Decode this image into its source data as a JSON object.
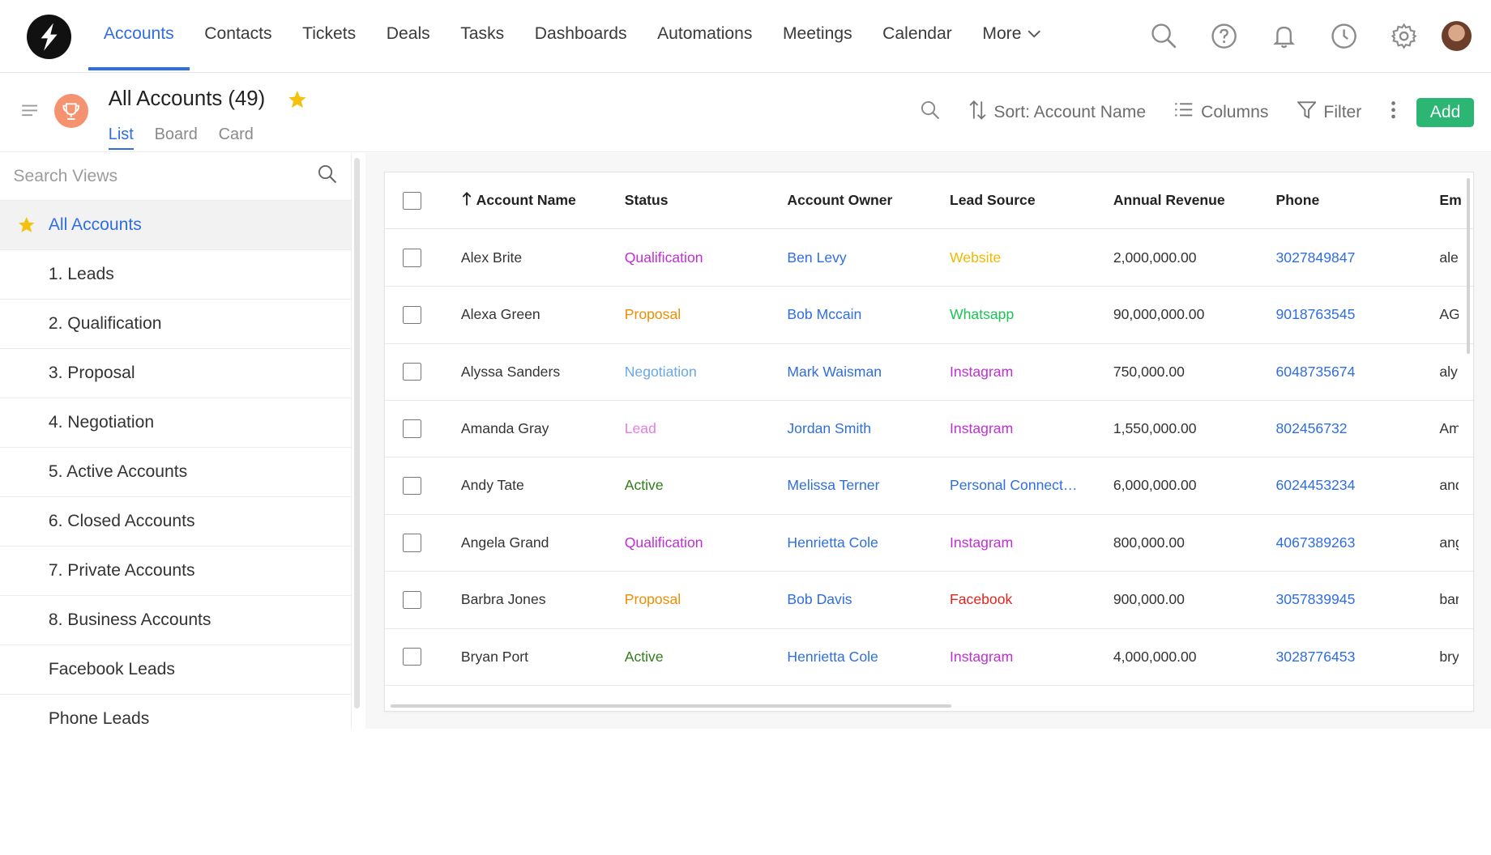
{
  "nav": {
    "items": [
      {
        "label": "Accounts",
        "active": true
      },
      {
        "label": "Contacts"
      },
      {
        "label": "Tickets"
      },
      {
        "label": "Deals"
      },
      {
        "label": "Tasks"
      },
      {
        "label": "Dashboards"
      },
      {
        "label": "Automations"
      },
      {
        "label": "Meetings"
      },
      {
        "label": "Calendar"
      }
    ],
    "more_label": "More",
    "icons": [
      "search-icon",
      "help-icon",
      "bell-icon",
      "clock-icon",
      "gear-icon",
      "avatar"
    ]
  },
  "header": {
    "title": "All Accounts",
    "count": "(49)",
    "view_tabs": [
      "List",
      "Board",
      "Card"
    ],
    "active_view": "List",
    "sort_label": "Sort: Account Name",
    "columns_label": "Columns",
    "filter_label": "Filter",
    "add_label": "Add"
  },
  "sidebar": {
    "search_placeholder": "Search Views",
    "items": [
      {
        "label": "All Accounts",
        "active": true
      },
      {
        "label": "1. Leads"
      },
      {
        "label": "2. Qualification"
      },
      {
        "label": "3. Proposal"
      },
      {
        "label": "4. Negotiation"
      },
      {
        "label": "5. Active Accounts"
      },
      {
        "label": "6. Closed Accounts"
      },
      {
        "label": "7. Private Accounts"
      },
      {
        "label": "8. Business Accounts"
      },
      {
        "label": "Facebook Leads"
      },
      {
        "label": "Phone Leads"
      }
    ]
  },
  "table": {
    "columns": [
      "Account Name",
      "Status",
      "Account Owner",
      "Lead Source",
      "Annual Revenue",
      "Phone",
      "Em"
    ],
    "rows": [
      {
        "name": "Alex Brite",
        "status": "Qualification",
        "owner": "Ben Levy",
        "source": "Website",
        "revenue": "2,000,000.00",
        "phone": "3027849847",
        "email": "ale"
      },
      {
        "name": "Alexa Green",
        "status": "Proposal",
        "owner": "Bob Mccain",
        "source": "Whatsapp",
        "revenue": "90,000,000.00",
        "phone": "9018763545",
        "email": "AG"
      },
      {
        "name": "Alyssa Sanders",
        "status": "Negotiation",
        "owner": "Mark Waisman",
        "source": "Instagram",
        "revenue": "750,000.00",
        "phone": "6048735674",
        "email": "aly"
      },
      {
        "name": "Amanda Gray",
        "status": "Lead",
        "owner": "Jordan Smith",
        "source": "Instagram",
        "revenue": "1,550,000.00",
        "phone": "802456732",
        "email": "Am"
      },
      {
        "name": "Andy Tate",
        "status": "Active",
        "owner": "Melissa Terner",
        "source": "Personal Connect…",
        "revenue": "6,000,000.00",
        "phone": "6024453234",
        "email": "and"
      },
      {
        "name": "Angela Grand",
        "status": "Qualification",
        "owner": "Henrietta Cole",
        "source": "Instagram",
        "revenue": "800,000.00",
        "phone": "4067389263",
        "email": "ang"
      },
      {
        "name": "Barbra Jones",
        "status": "Proposal",
        "owner": "Bob Davis",
        "source": "Facebook",
        "revenue": "900,000.00",
        "phone": "3057839945",
        "email": "bar"
      },
      {
        "name": "Bryan Port",
        "status": "Active",
        "owner": "Henrietta Cole",
        "source": "Instagram",
        "revenue": "4,000,000.00",
        "phone": "3028776453",
        "email": "bry"
      }
    ]
  },
  "colors": {
    "accent": "#2f6ee0",
    "add_button": "#2bb673",
    "status": {
      "Qualification": "#c02fd6",
      "Proposal": "#f08c00",
      "Negotiation": "#6aa6ea",
      "Lead": "#e57be6",
      "Active": "#2f7d18"
    },
    "source": {
      "Website": "#f1b800",
      "Whatsapp": "#1dc254",
      "Instagram": "#c02fd6",
      "Personal Connect…": "#2f6ee0",
      "Facebook": "#e0241e"
    }
  }
}
